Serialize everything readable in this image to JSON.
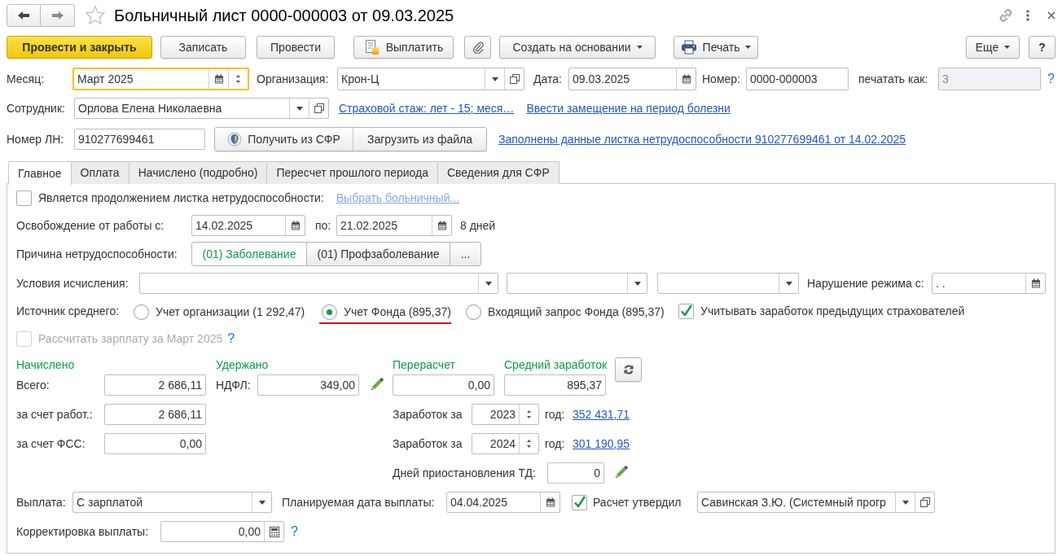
{
  "window": {
    "title": "Больничный лист 0000-000003 от 09.03.2025",
    "favorite": false
  },
  "toolbar": {
    "post_close": "Провести и закрыть",
    "save": "Записать",
    "post": "Провести",
    "pay": "Выплатить",
    "create_based": "Создать на основании",
    "print": "Печать",
    "more": "Еще",
    "help": "?"
  },
  "header": {
    "month": {
      "label": "Месяц:",
      "value": "Март 2025",
      "focused": true
    },
    "organization": {
      "label": "Организация:",
      "value": "Крон-Ц"
    },
    "date": {
      "label": "Дата:",
      "value": "09.03.2025"
    },
    "number": {
      "label": "Номер:",
      "value": "0000-000003"
    },
    "print_as": {
      "label": "печатать как:",
      "placeholder": "3",
      "disabled": true
    },
    "help": "?",
    "employee": {
      "label": "Сотрудник:",
      "value": "Орлова Елена Николаевна"
    },
    "insurance_link": "Страховой стаж: лет - 15; меся…",
    "replacement_link": "Ввести замещение на период болезни",
    "ln_number": {
      "label": "Номер ЛН:",
      "value": "910277699461"
    },
    "get_sfr": "Получить из СФР",
    "load_file": "Загрузить из файла",
    "filled_link": "Заполнены данные листка нетрудоспособности 910277699461 от 14.02.2025"
  },
  "tabs": [
    {
      "label": "Главное",
      "selected": true
    },
    {
      "label": "Оплата",
      "selected": false
    },
    {
      "label": "Начислено (подробно)",
      "selected": false
    },
    {
      "label": "Пересчет прошлого периода",
      "selected": false
    },
    {
      "label": "Сведения для СФР",
      "selected": false
    }
  ],
  "main": {
    "continuation": {
      "label": "Является продолжением листка нетрудоспособности:",
      "checked": false,
      "link": "Выбрать больничный..."
    },
    "release": {
      "label": "Освобождение от работы с:",
      "from": "14.02.2025",
      "to_label": "по:",
      "to": "21.02.2025",
      "days": "8 дней"
    },
    "cause": {
      "label": "Причина нетрудоспособности:",
      "options": [
        {
          "label": "(01) Заболевание",
          "selected": true
        },
        {
          "label": "(01) Профзаболевание",
          "selected": false
        }
      ],
      "more": "..."
    },
    "conditions": {
      "label": "Условия исчисления:",
      "violation_label": "Нарушение режима с:",
      "violation_value": " .  ."
    },
    "average_source": {
      "label": "Источник среднего:",
      "options": [
        {
          "label": "Учет организации (1 292,47)",
          "selected": false,
          "underlined": false
        },
        {
          "label": "Учет Фонда (895,37)",
          "selected": true,
          "underlined": true
        },
        {
          "label": "Входящий запрос Фонда (895,37)",
          "selected": false,
          "underlined": false
        }
      ]
    },
    "prev_insurers": {
      "label": "Учитывать заработок предыдущих страхователей",
      "checked": true
    },
    "recalc_salary": {
      "label": "Рассчитать зарплату за Март 2025",
      "checked": false,
      "disabled": true,
      "help": "?"
    },
    "accrued": {
      "title": "Начислено",
      "total_label": "Всего:",
      "total": "2 686,11",
      "employer_label": "за счет работ.:",
      "employer": "2 686,11",
      "fss_label": "за счет ФСС:",
      "fss": "0,00"
    },
    "withheld": {
      "title": "Удержано",
      "ndfl_label": "НДФЛ:",
      "ndfl": "349,00"
    },
    "recalc": {
      "title": "Перерасчет",
      "value": "0,00"
    },
    "average": {
      "title": "Средний заработок",
      "value": "895,37"
    },
    "earnings": [
      {
        "label": "Заработок за",
        "year": "2023",
        "unit": "год:",
        "amount": "352 431,71"
      },
      {
        "label": "Заработок за",
        "year": "2024",
        "unit": "год:",
        "amount": "301 190,95"
      }
    ],
    "suspension": {
      "label": "Дней приостановления ТД:",
      "value": "0"
    },
    "payment": {
      "label": "Выплата:",
      "value": "С зарплатой",
      "date_label": "Планируемая дата выплаты:",
      "date": "04.04.2025",
      "approved_label": "Расчет утвердил",
      "approved": true,
      "approver": "Савинская З.Ю. (Системный прогр"
    },
    "correction": {
      "label": "Корректировка выплаты:",
      "value": "0,00",
      "help": "?"
    }
  }
}
